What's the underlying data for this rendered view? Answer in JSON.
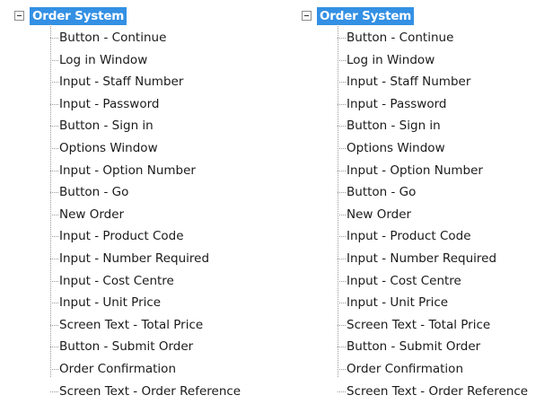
{
  "trees": [
    {
      "root_label": "Order System",
      "items": [
        "Button - Continue",
        "Log in Window",
        "Input - Staff Number",
        "Input - Password",
        "Button - Sign in",
        "Options Window",
        "Input - Option Number",
        "Button - Go",
        "New Order",
        "Input - Product Code",
        "Input - Number Required",
        "Input - Cost Centre",
        "Input - Unit Price",
        "Screen Text - Total Price",
        "Button - Submit Order",
        "Order Confirmation",
        "Screen Text - Order Reference"
      ]
    },
    {
      "root_label": "Order System",
      "items": [
        "Button - Continue",
        "Log in Window",
        "Input - Staff Number",
        "Input - Password",
        "Button - Sign in",
        "Options Window",
        "Input - Option Number",
        "Button - Go",
        "New Order",
        "Input - Product Code",
        "Input - Number Required",
        "Input - Cost Centre",
        "Input - Unit Price",
        "Screen Text - Total Price",
        "Button - Submit Order",
        "Order Confirmation",
        "Screen Text - Order Reference"
      ]
    }
  ],
  "icons": {
    "expander": "collapse-minus-icon"
  },
  "colors": {
    "selection_background": "#3390e4",
    "selection_text": "#ffffff",
    "connector_line": "#9a9a9a"
  }
}
